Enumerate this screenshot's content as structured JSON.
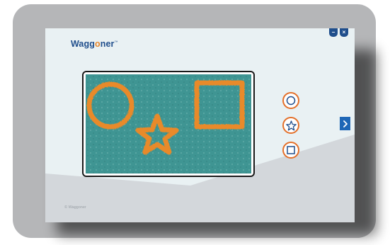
{
  "app": {
    "logo_prefix": "Wagg",
    "logo_ring": "o",
    "logo_suffix": "ner",
    "logo_mark": "™",
    "copyright": "© Waggoner"
  },
  "window_controls": {
    "minimize_label": "−",
    "close_label": "×"
  },
  "drawing_board": {
    "fill_color": "#3f9593",
    "stroke_color": "#e88a2a",
    "shapes_drawn": [
      "circle",
      "star",
      "square"
    ]
  },
  "shape_tools": [
    {
      "name": "circle",
      "icon": "circle-icon"
    },
    {
      "name": "star",
      "icon": "star-icon"
    },
    {
      "name": "square",
      "icon": "square-icon"
    }
  ],
  "navigation": {
    "next_icon": "chevron-right-icon"
  },
  "colors": {
    "brand_blue": "#1f4e8c",
    "accent_orange": "#e36f29",
    "next_blue": "#1f67b6",
    "frame_gray": "#b5b6b8"
  }
}
